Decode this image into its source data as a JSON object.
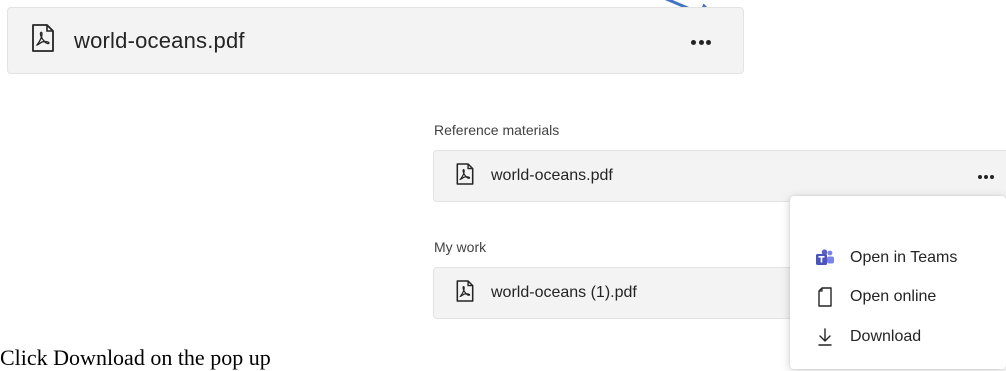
{
  "top_card": {
    "file_name": "world-oceans.pdf"
  },
  "reference": {
    "label": "Reference materials",
    "file_name": "world-oceans.pdf"
  },
  "my_work": {
    "label": "My work",
    "file_name": "world-oceans (1).pdf"
  },
  "popup_menu": {
    "items": [
      {
        "label": "Open in Teams",
        "icon": "teams-icon"
      },
      {
        "label": "Open online",
        "icon": "document-icon"
      },
      {
        "label": "Download",
        "icon": "download-icon"
      }
    ]
  },
  "caption": "Click Download on the pop up",
  "colors": {
    "card_bg": "#f3f3f3",
    "arrow": "#4472c4",
    "teams_purple": "#5b5fc7"
  }
}
